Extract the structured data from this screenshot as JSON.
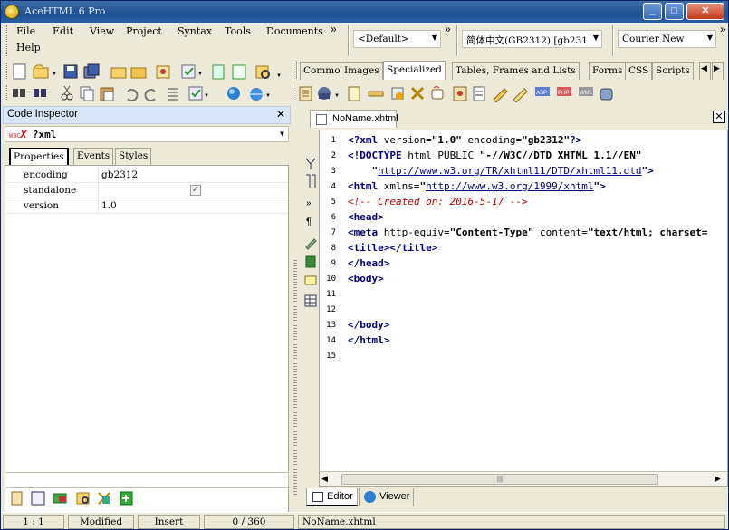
{
  "window": {
    "title": "AceHTML 6 Pro",
    "min": "_",
    "max": "□",
    "close": "✕"
  },
  "menu": {
    "file": "File",
    "edit": "Edit",
    "view": "View",
    "project": "Project",
    "syntax": "Syntax",
    "tools": "Tools",
    "documents": "Documents",
    "help": "Help"
  },
  "combos": {
    "doctype": "<Default>",
    "encoding": "简体中文(GB2312) [gb231",
    "font": "Courier New",
    "chevron": "»"
  },
  "code_tabs": [
    "Common",
    "Images",
    "Specialized",
    "Tables, Frames and Lists",
    "Forms",
    "CSS",
    "Scripts"
  ],
  "inspector": {
    "title": "Code Inspector",
    "object": "?xml",
    "tabs": [
      "Properties",
      "Events",
      "Styles"
    ],
    "props": [
      {
        "name": "encoding",
        "value": "gb2312"
      },
      {
        "name": "standalone",
        "value": "",
        "checked": true
      },
      {
        "name": "version",
        "value": "1.0"
      }
    ]
  },
  "document": {
    "tab": "NoName.xhtml",
    "lines": [
      {
        "n": "1",
        "html": "<span class='kw'>&lt;?xml</span> version=<span class='st'>\"1.0\"</span> encoding=<span class='st'>\"gb2312\"</span><span class='kw'>?&gt;</span>"
      },
      {
        "n": "2",
        "html": "<span class='kw'>&lt;!DOCTYPE</span> html PUBLIC <span class='st'>\"-//W3C//DTD XHTML 1.1//EN\"</span>"
      },
      {
        "n": "3",
        "html": "    <span class='st'>\"</span><span class='lk'>http://www.w3.org/TR/xhtml11/DTD/xhtml11.dtd</span><span class='st'>\"</span><span class='kw'>&gt;</span>"
      },
      {
        "n": "4",
        "html": "<span class='kw'>&lt;html</span> xmlns=<span class='st'>\"</span><span class='lk'>http://www.w3.org/1999/xhtml</span><span class='st'>\"</span><span class='kw'>&gt;</span>"
      },
      {
        "n": "5",
        "html": "<span class='cm'>&lt;!-- Created on: 2016-5-17 --&gt;</span>"
      },
      {
        "n": "6",
        "html": "<span class='kw'>&lt;head&gt;</span>"
      },
      {
        "n": "7",
        "html": "<span class='kw'>&lt;meta</span> http-equiv=<span class='st'>\"Content-Type\"</span> content=<span class='st'>\"text/html; charset=</span>"
      },
      {
        "n": "8",
        "html": "<span class='kw'>&lt;title&gt;&lt;/title&gt;</span>"
      },
      {
        "n": "9",
        "html": "<span class='kw'>&lt;/head&gt;</span>"
      },
      {
        "n": "10",
        "html": "<span class='kw'>&lt;body&gt;</span>"
      },
      {
        "n": "11",
        "html": ""
      },
      {
        "n": "12",
        "html": ""
      },
      {
        "n": "13",
        "html": "<span class='kw'>&lt;/body&gt;</span>"
      },
      {
        "n": "14",
        "html": "<span class='kw'>&lt;/html&gt;</span>"
      },
      {
        "n": "15",
        "html": ""
      }
    ]
  },
  "bottom_tabs": {
    "editor": "Editor",
    "viewer": "Viewer"
  },
  "status": {
    "position": "1 : 1",
    "modified": "Modified",
    "mode": "Insert",
    "count": "0 / 360",
    "file": "NoName.xhtml"
  },
  "colors": {
    "titlebar": "#1d4f91",
    "panel_head": "#d8e4f8",
    "keyword": "#000080",
    "comment": "#c00000"
  }
}
